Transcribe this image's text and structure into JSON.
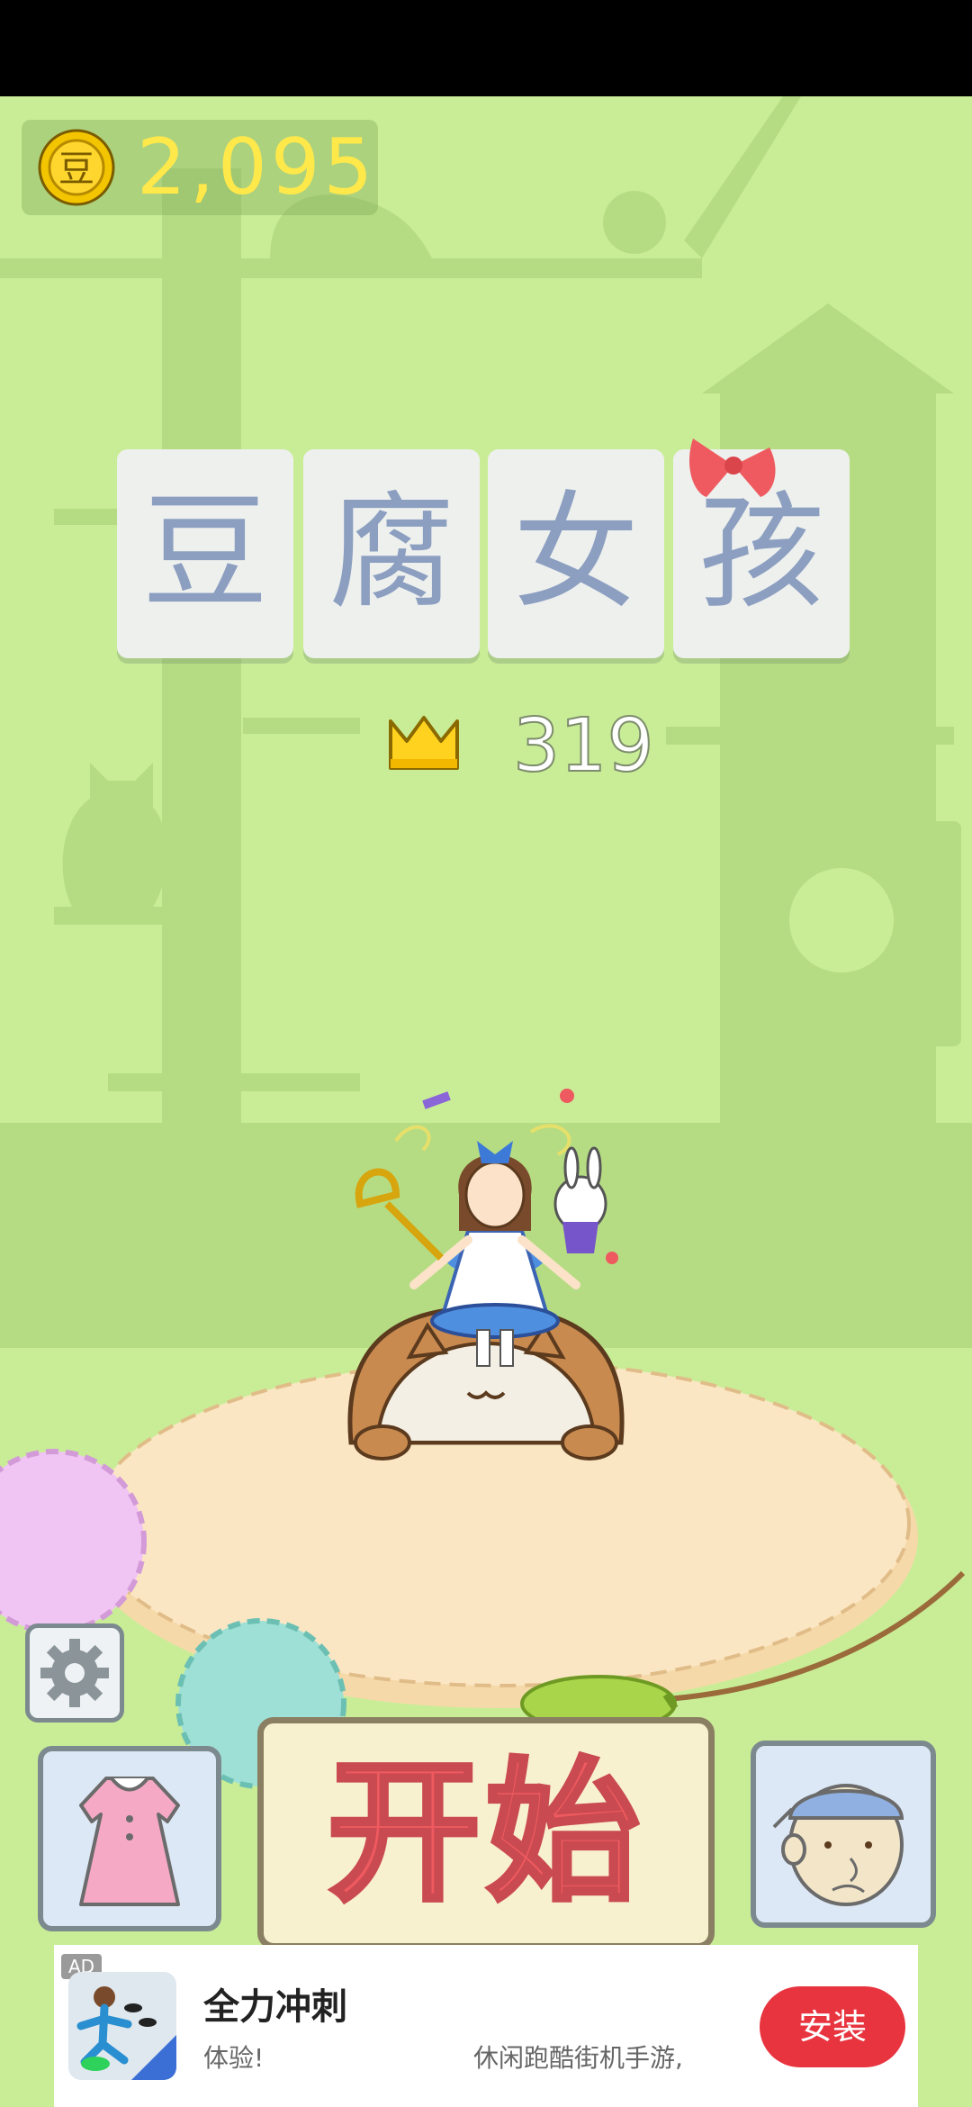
{
  "hud": {
    "coin_icon_char": "豆",
    "coins": "2,095",
    "crown_score": "319"
  },
  "title": {
    "tiles": [
      "豆",
      "腐",
      "女",
      "孩"
    ]
  },
  "buttons": {
    "start_label": "开始"
  },
  "ad": {
    "badge": "AD",
    "title": "全力冲刺",
    "subtitle_left": "体验!",
    "subtitle_right": "休闲跑酷街机手游,",
    "install_label": "安装"
  },
  "colors": {
    "background": "#c9ed97",
    "coin_text": "#ffe84a",
    "title_text": "#8c9fc0",
    "start_text": "#ee5a5f",
    "install_button": "#e8343f"
  },
  "icons": [
    "coin-icon",
    "crown-icon",
    "gear-icon",
    "dress-icon",
    "character-face-icon"
  ]
}
